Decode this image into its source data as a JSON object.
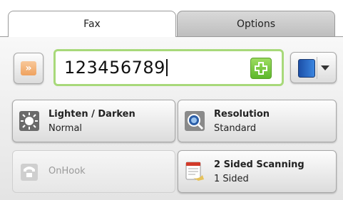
{
  "tabs": [
    {
      "label": "Fax",
      "selected": true
    },
    {
      "label": "Options",
      "selected": false
    }
  ],
  "entry": {
    "value": "123456789"
  },
  "buttons": {
    "lighten_darken": {
      "title": "Lighten / Darken",
      "value": "Normal",
      "icon": "sun-icon"
    },
    "resolution": {
      "title": "Resolution",
      "value": "Standard",
      "icon": "resolution-icon"
    },
    "onhook": {
      "title": "OnHook",
      "enabled": false,
      "icon": "phone-icon"
    },
    "two_sided": {
      "title": "2 Sided Scanning",
      "value": "1 Sided",
      "icon": "two-sided-icon"
    }
  },
  "colors": {
    "entry_border": "#a8d97a",
    "add_button": "#5db82b"
  }
}
